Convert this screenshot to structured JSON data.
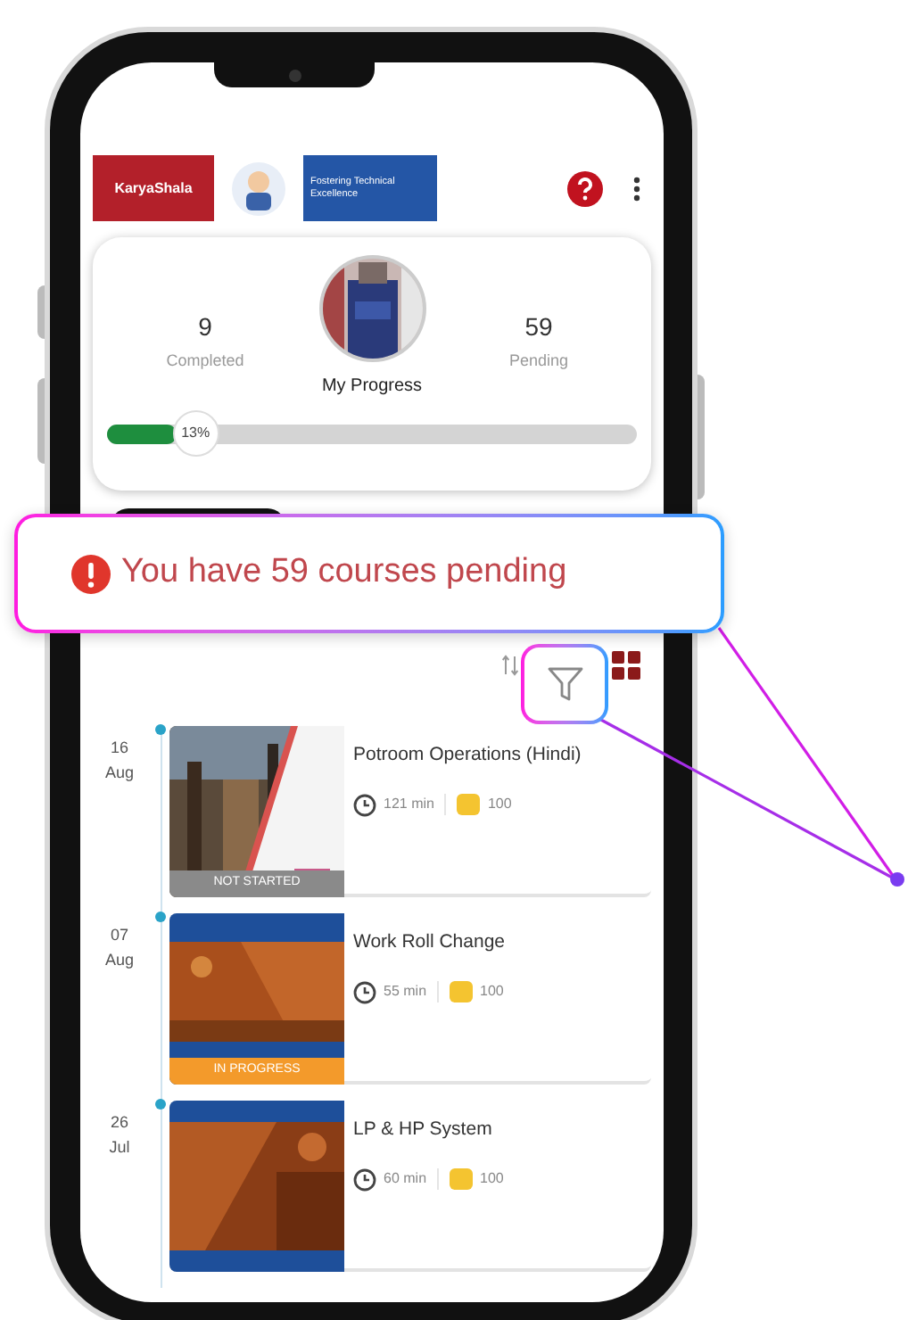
{
  "header": {
    "brand": "KaryaShala",
    "tagline": "Fostering Technical Excellence"
  },
  "progress": {
    "completed": "9",
    "completed_label": "Completed",
    "title": "My Progress",
    "pending": "59",
    "pending_label": "Pending",
    "level": 0.13,
    "percent": "13%"
  },
  "callout": {
    "message": "You have 59 courses pending"
  },
  "courses": [
    {
      "day": "16",
      "month": "Aug",
      "title": "Potroom Operations (Hindi)",
      "duration": "121 min",
      "points": "100",
      "status": "NOT STARTED",
      "color": "#8a8a8a"
    },
    {
      "day": "07",
      "month": "Aug",
      "title": "Work Roll Change",
      "duration": "55 min",
      "points": "100",
      "status": "IN PROGRESS",
      "color": "#f39a2b"
    },
    {
      "day": "26",
      "month": "Jul",
      "title": "LP & HP System",
      "duration": "60 min",
      "points": "100"
    }
  ]
}
